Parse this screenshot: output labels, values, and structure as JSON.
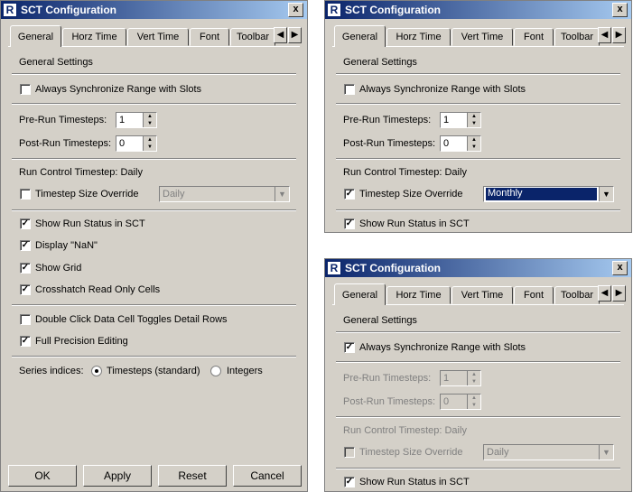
{
  "title": "SCT Configuration",
  "close_label": "x",
  "tabs": [
    "General",
    "Horz Time",
    "Vert Time",
    "Font",
    "Toolbar"
  ],
  "tab_nav": {
    "left": "◀",
    "right": "▶"
  },
  "section_title": "General Settings",
  "always_sync_label": "Always Synchronize Range with Slots",
  "pre_run_label": "Pre-Run Timesteps:",
  "pre_run_value": "1",
  "post_run_label": "Post-Run Timesteps:",
  "post_run_value": "0",
  "run_control_label": "Run Control Timestep:  Daily",
  "timestep_override_label": "Timestep Size Override",
  "show_run_status_label": "Show Run Status in SCT",
  "display_nan_label": "Display \"NaN\"",
  "show_grid_label": "Show Grid",
  "crosshatch_label": "Crosshatch Read Only Cells",
  "double_click_label": "Double Click Data Cell Toggles Detail Rows",
  "full_precision_label": "Full Precision Editing",
  "series_indices_label": "Series indices:",
  "radio_timesteps_label": "Timesteps (standard)",
  "radio_integers_label": "Integers",
  "buttons": {
    "ok": "OK",
    "apply": "Apply",
    "reset": "Reset",
    "cancel": "Cancel"
  },
  "check_mark": "✓",
  "dialog_main": {
    "always_sync": false,
    "timestep_override": false,
    "override_value": "Daily",
    "show_run_status": true,
    "display_nan": true,
    "show_grid": true,
    "crosshatch": true,
    "double_click": false,
    "full_precision": true,
    "series_indices_selected": "Timesteps (standard)"
  },
  "dialog_top_right": {
    "always_sync": false,
    "timestep_override": true,
    "override_value": "Monthly",
    "show_run_status": true
  },
  "dialog_bottom_right": {
    "always_sync": true,
    "timestep_override": false,
    "override_value": "Daily",
    "show_run_status": true,
    "controls_disabled": true
  },
  "colors": {
    "title_bar_start": "#0a246a",
    "title_bar_end": "#a6caf0",
    "dialog_face": "#d4d0c8",
    "selection": "#0a246a",
    "disabled_text": "#808080"
  },
  "icons": {
    "app": "riverware-logo-icon",
    "close": "close-icon",
    "checkbox": "checkmark-icon",
    "spinner": "spinner-arrows-icon",
    "dropdown": "chevron-down-icon"
  }
}
